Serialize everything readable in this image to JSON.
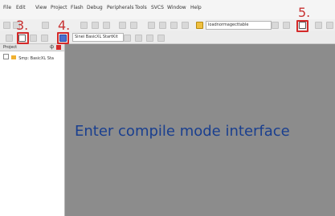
{
  "menu": {
    "items": [
      "File",
      "Edit",
      "View",
      "Project",
      "Flash",
      "Debug",
      "Peripherals",
      "Tools",
      "SVCS",
      "Window",
      "Help"
    ]
  },
  "toolbar": {
    "target_dropdown": "Sinei BasicXL StartKit",
    "search_dropdown": "loadnormagecttable"
  },
  "sidebar": {
    "header": "Project",
    "tree_item": "Smp: BasicXL Sta"
  },
  "steps": {
    "three": "3.",
    "four": "4.",
    "five": "5."
  },
  "caption": "Enter compile mode interface",
  "colors": {
    "highlight": "#d42a2a",
    "caption": "#1a3f8f",
    "editor_bg": "#8c8c8c"
  }
}
